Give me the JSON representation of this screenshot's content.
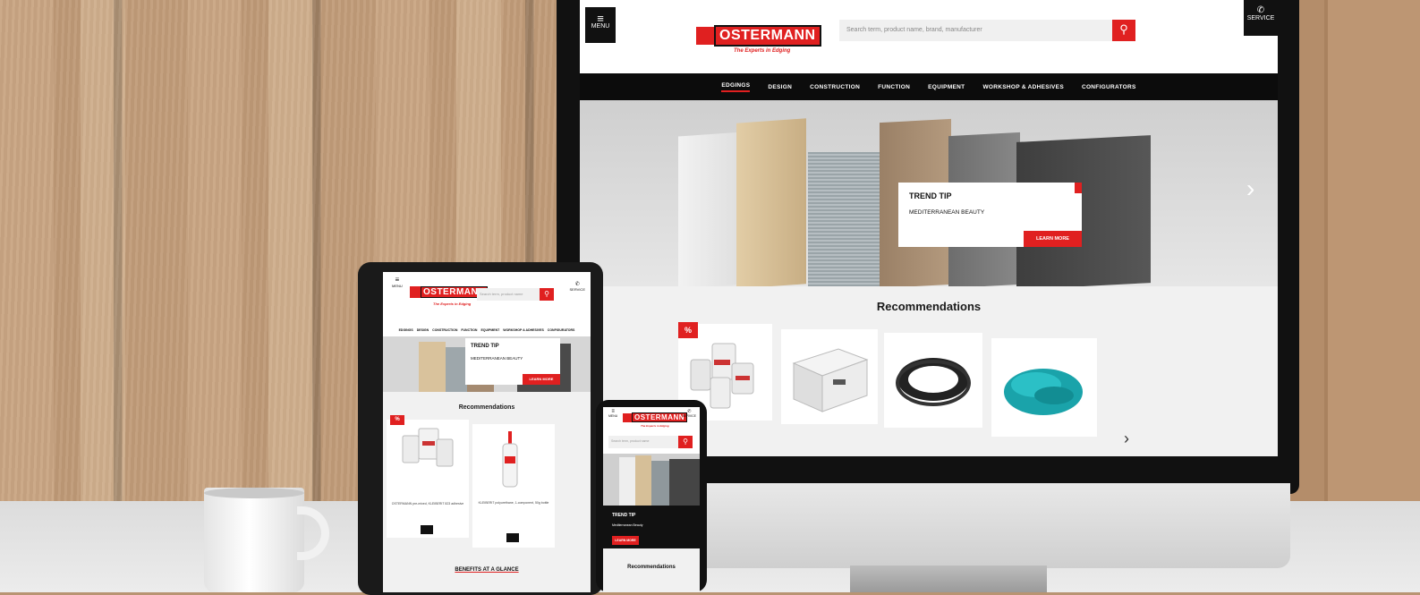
{
  "brand": {
    "name": "OSTERMANN",
    "tagline": "The Experts in Edging",
    "accent_color": "#e02020",
    "dark_color": "#0c0c0c"
  },
  "desktop": {
    "menu_label": "MENU",
    "menu_icon": "hamburger-icon",
    "service_label": "SERVICE",
    "service_icon": "phone-icon",
    "search_placeholder": "Search term, product name, brand, manufacturer",
    "search_icon": "search-icon",
    "nav": [
      "EDGINGS",
      "DESIGN",
      "CONSTRUCTION",
      "FUNCTION",
      "EQUIPMENT",
      "WORKSHOP & ADHESIVES",
      "CONFIGURATORS"
    ],
    "hero": {
      "title": "TREND TIP",
      "subtitle": "MEDITERRANEAN BEAUTY",
      "button": "LEARN MORE",
      "prev_icon": "chevron-left-icon",
      "next_icon": "chevron-right-icon"
    },
    "recommendations_title": "Recommendations",
    "badge": "%",
    "products": [
      "adhesive-bottles",
      "edge-band-box",
      "rubber-ring",
      "turquoise-granules"
    ],
    "next_icon": "chevron-right-icon"
  },
  "tablet": {
    "menu_label": "MENU",
    "service_label": "SERVICE",
    "search_placeholder": "Search term, product name",
    "nav": [
      "EDGINGS",
      "DESIGN",
      "CONSTRUCTION",
      "FUNCTION",
      "EQUIPMENT",
      "WORKSHOP & ADHESIVES",
      "CONFIGURATORS"
    ],
    "hero": {
      "title": "TREND TIP",
      "subtitle": "MEDITERRANEAN BEAUTY",
      "button": "LEARN MORE"
    },
    "recommendations_title": "Recommendations",
    "badge": "%",
    "product_captions": [
      "OSTERMANN pre-mixed, KLEIBERIT 823 adhesive",
      "KLEIBERIT polyurethane, 1-component, 50g bottle"
    ],
    "benefits_title": "BENEFITS AT A GLANCE"
  },
  "phone": {
    "menu_label": "MENU",
    "service_label": "SERVICE",
    "search_placeholder": "Search term, product name",
    "trend_title": "TREND TIP",
    "trend_subtitle": "Mediterranean Beauty",
    "trend_button": "LEARN MORE",
    "recommendations_title": "Recommendations"
  }
}
